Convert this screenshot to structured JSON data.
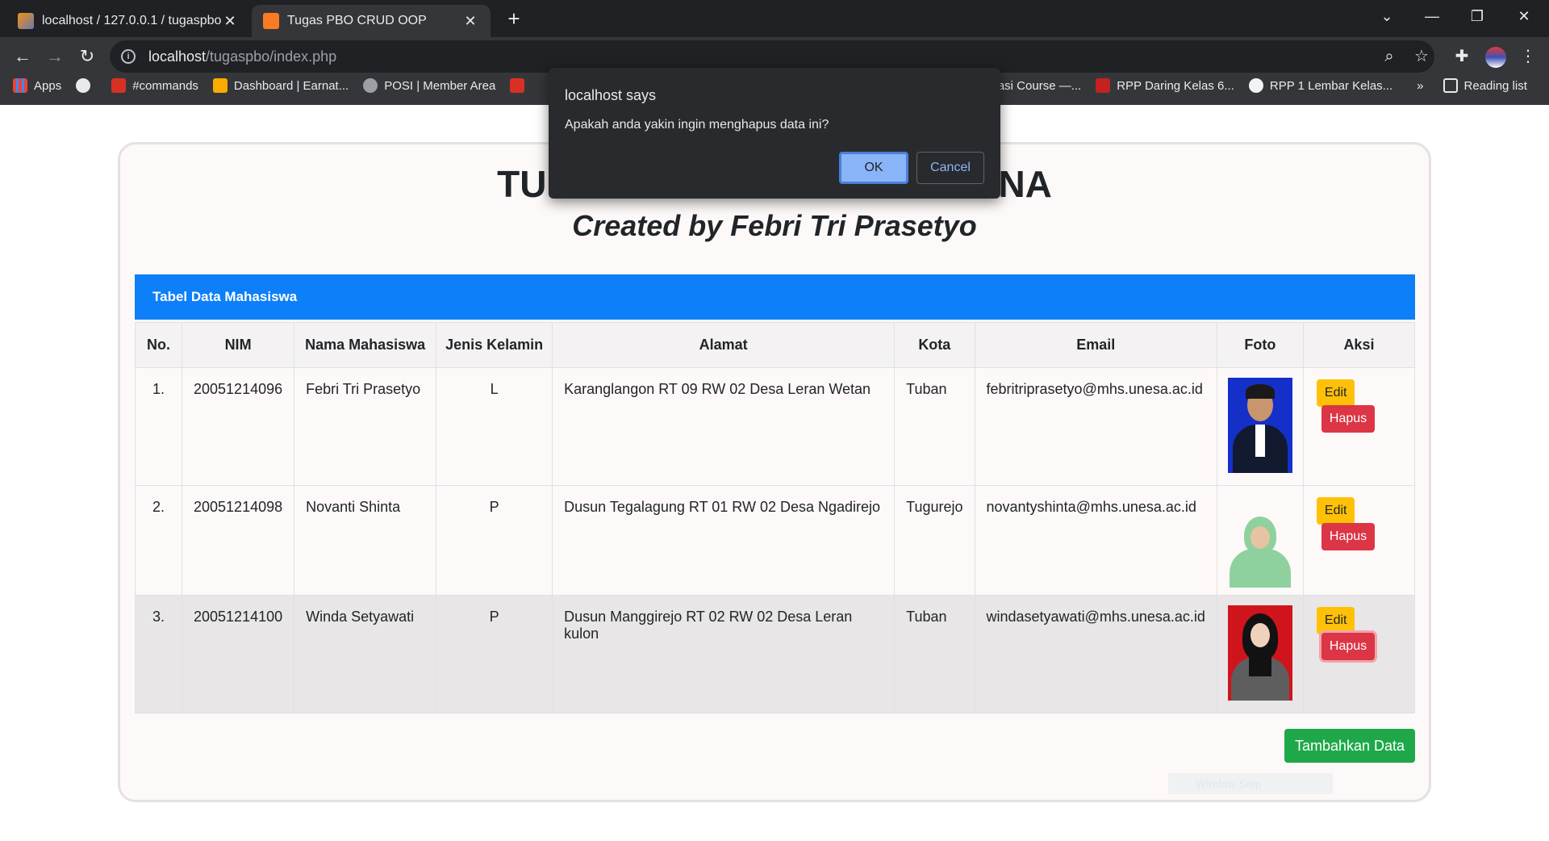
{
  "browser": {
    "tabs": [
      {
        "title": "localhost / 127.0.0.1 / tugaspbo /",
        "active": false
      },
      {
        "title": "Tugas PBO CRUD OOP",
        "active": true
      }
    ],
    "url_host": "localhost",
    "url_path": "/tugaspbo/index.php",
    "bookmarks": [
      "Apps",
      "#commands",
      "Dashboard | Earnat...",
      "POSI | Member Area",
      "masi Course —...",
      "RPP Daring Kelas 6...",
      "RPP 1 Lembar Kelas..."
    ],
    "reading_list": "Reading list",
    "more": "»"
  },
  "page": {
    "title": "TUGAS PBO CRUD MAHASISWA UNESA",
    "title_left": "TU",
    "title_right": "NA",
    "subtitle": "Created by Febri Tri Prasetyo",
    "table_caption": "Tabel Data Mahasiswa",
    "columns": [
      "No.",
      "NIM",
      "Nama Mahasiswa",
      "Jenis Kelamin",
      "Alamat",
      "Kota",
      "Email",
      "Foto",
      "Aksi"
    ],
    "rows": [
      {
        "no": "1.",
        "nim": "20051214096",
        "nama": "Febri Tri Prasetyo",
        "jk": "L",
        "alamat": "Karanglangon RT 09 RW 02 Desa Leran Wetan",
        "kota": "Tuban",
        "email": "febritriprasetyo@mhs.unesa.ac.id"
      },
      {
        "no": "2.",
        "nim": "20051214098",
        "nama": "Novanti Shinta",
        "jk": "P",
        "alamat": "Dusun Tegalagung RT 01 RW 02 Desa Ngadirejo",
        "kota": "Tugurejo",
        "email": "novantyshinta@mhs.unesa.ac.id"
      },
      {
        "no": "3.",
        "nim": "20051214100",
        "nama": "Winda Setyawati",
        "jk": "P",
        "alamat": "Dusun Manggirejo RT 02 RW 02 Desa Leran kulon",
        "kota": "Tuban",
        "email": "windasetyawati@mhs.unesa.ac.id"
      }
    ],
    "edit_label": "Edit",
    "hapus_label": "Hapus",
    "add_label": "Tambahkan Data",
    "ghost_label": "Window Snip"
  },
  "dialog": {
    "title": "localhost says",
    "message": "Apakah anda yakin ingin menghapus data ini?",
    "ok": "OK",
    "cancel": "Cancel"
  },
  "colors": {
    "header_bar": "#0d7ff8",
    "edit": "#ffc107",
    "hapus": "#dc3545",
    "add": "#1fa84a",
    "ok": "#8ab4f8"
  }
}
